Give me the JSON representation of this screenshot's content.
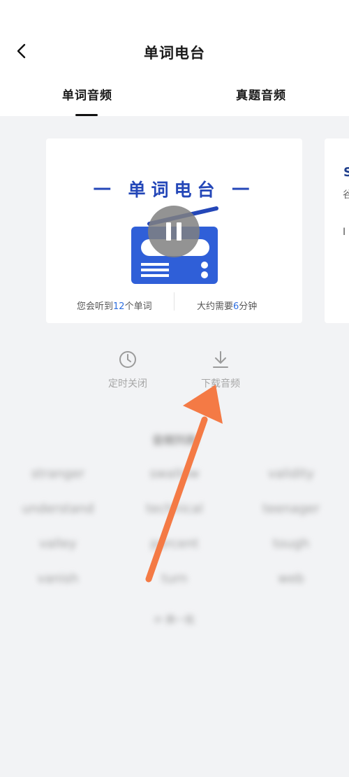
{
  "header": {
    "title": "单词电台",
    "back_icon": "chevron-left-icon"
  },
  "tabs": [
    {
      "label": "单词音频",
      "active": true
    },
    {
      "label": "真题音频",
      "active": false
    }
  ],
  "card": {
    "title": "一 单词电台 一",
    "stat_left_prefix": "您会听到",
    "stat_left_count": "12",
    "stat_left_suffix": "个单词",
    "stat_right_prefix": "大约需要",
    "stat_right_count": "6",
    "stat_right_suffix": "分钟",
    "player_state": "pause-icon",
    "accent_color": "#2447b8"
  },
  "next_card_peek": {
    "title_fragment": "S",
    "line1_fragment": "谷",
    "line2_fragment": "I"
  },
  "actions": [
    {
      "label": "定时关闭",
      "icon": "clock-icon"
    },
    {
      "label": "下载音频",
      "icon": "download-icon"
    }
  ],
  "word_list": {
    "title": "音频列表",
    "words": [
      "stranger",
      "swallow",
      "validity",
      "understand",
      "technical",
      "teenager",
      "valley",
      "percent",
      "tough",
      "vanish",
      "turn",
      "web"
    ],
    "more_label": "换一批"
  },
  "annotation": {
    "arrow_color": "#f47a45"
  }
}
